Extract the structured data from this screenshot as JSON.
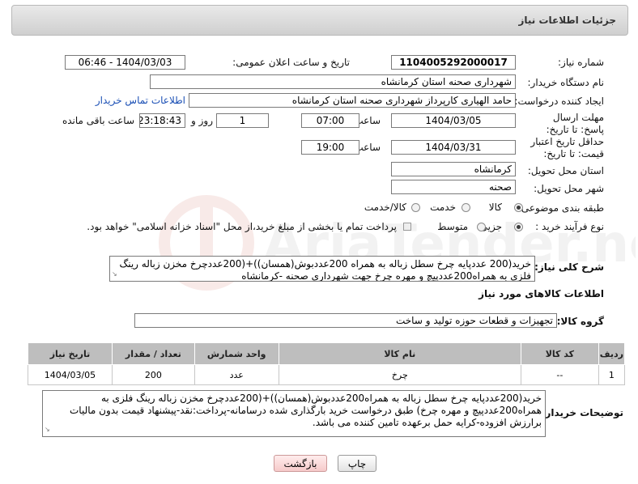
{
  "header": {
    "title": "جزئیات اطلاعات نیاز"
  },
  "need_number": {
    "label": "شماره نیاز:",
    "value": "1104005292000017"
  },
  "announce_datetime": {
    "label": "تاریخ و ساعت اعلان عمومی:",
    "value": "1404/03/03 - 06:46"
  },
  "buyer_org": {
    "label": "نام دستگاه خریدار:",
    "value": "شهرداری صحنه استان کرمانشاه"
  },
  "requester": {
    "label": "ایجاد کننده درخواست:",
    "value": "حامد الهیاری کارپرداز شهرداری صحنه استان کرمانشاه",
    "contact_link": "اطلاعات تماس خریدار"
  },
  "reply_deadline": {
    "label": "مهلت ارسال پاسخ: تا تاریخ:",
    "date": "1404/03/05",
    "time_label": "ساعت",
    "time": "07:00",
    "days": "1",
    "days_label": "روز و",
    "remaining": "23:18:43",
    "remaining_label": "ساعت باقی مانده"
  },
  "price_validity": {
    "label": "حداقل تاریخ اعتبار قیمت: تا تاریخ:",
    "date": "1404/03/31",
    "time_label": "ساعت",
    "time": "19:00"
  },
  "delivery_province": {
    "label": "استان محل تحویل:",
    "value": "کرمانشاه"
  },
  "delivery_city": {
    "label": "شهر محل تحویل:",
    "value": "صحنه"
  },
  "category": {
    "label": "طبقه بندی موضوعی:",
    "options": [
      "کالا",
      "خدمت",
      "کالا/خدمت"
    ],
    "selected": "کالا"
  },
  "purchase_process": {
    "label": "نوع فرآیند خرید :",
    "options": [
      "جزیی",
      "متوسط"
    ],
    "selected": "جزیی",
    "note": "پرداخت تمام یا بخشی از مبلغ خرید،از محل \"اسناد خزانه اسلامی\" خواهد بود."
  },
  "summary": {
    "label": "شرح کلی نیاز:",
    "text": "خرید(200 عددپایه چرخ سطل زباله به همراه 200عددبوش(همسان))+(200عددچرخ مخزن زباله رینگ فلزی به همراه200عددپیچ و مهره چرخ جهت شهرداری صحنه -کرمانشاه"
  },
  "goods_section": {
    "title": "اطلاعات کالاهای مورد نیاز"
  },
  "goods_group": {
    "label": "گروه کالا:",
    "value": "تجهیزات و قطعات حوزه تولید و ساخت"
  },
  "table": {
    "headers": [
      "ردیف",
      "کد کالا",
      "نام کالا",
      "واحد شمارش",
      "تعداد / مقدار",
      "تاریخ نیاز"
    ],
    "rows": [
      [
        "1",
        "--",
        "چرخ",
        "عدد",
        "200",
        "1404/03/05"
      ]
    ]
  },
  "buyer_notes": {
    "label": "توضیحات خریدار:",
    "text": "خرید(200عددپایه چرخ سطل زباله به همراه200عددبوش(همسان))+(200عددچرخ مخزن زباله رینگ فلزی به همراه200عددپیچ و مهره چرخ) طبق درخواست خرید بارگذاری شده درسامانه-پرداخت:نقد-پیشنهاد قیمت بدون مالیات برارزش افزوده-کرایه حمل برعهده تامین کننده می باشد."
  },
  "buttons": {
    "print": "چاپ",
    "back": "بازگشت"
  },
  "watermark_text": "AriaTender.net"
}
